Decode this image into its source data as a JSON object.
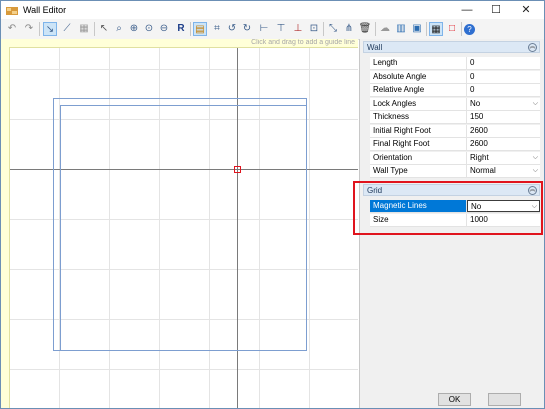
{
  "window": {
    "title": "Wall Editor",
    "minimize_glyph": "—",
    "maximize_glyph": "☐",
    "close_glyph": "✕"
  },
  "canvas": {
    "hint": "Click and drag to add a guide line"
  },
  "wall_group": {
    "label": "Wall",
    "properties": [
      {
        "name": "Length",
        "value": "0",
        "dropdown": false
      },
      {
        "name": "Absolute Angle",
        "value": "0",
        "dropdown": false
      },
      {
        "name": "Relative Angle",
        "value": "0",
        "dropdown": false
      },
      {
        "name": "Lock Angles",
        "value": "No",
        "dropdown": true
      },
      {
        "name": "Thickness",
        "value": "150",
        "dropdown": false
      },
      {
        "name": "Initial Right Foot",
        "value": "2600",
        "dropdown": false
      },
      {
        "name": "Final Right Foot",
        "value": "2600",
        "dropdown": false
      },
      {
        "name": "Orientation",
        "value": "Right",
        "dropdown": true
      },
      {
        "name": "Wall Type",
        "value": "Normal",
        "dropdown": true
      }
    ]
  },
  "grid_group": {
    "label": "Grid",
    "properties": [
      {
        "name": "Magnetic Lines",
        "value": "No",
        "dropdown": true,
        "selected": true
      },
      {
        "name": "Size",
        "value": "1000",
        "dropdown": false
      }
    ]
  },
  "buttons": {
    "ok": "OK",
    "cancel": ""
  },
  "colors": {
    "accent": "#0078d7",
    "highlight": "#e0141e",
    "wall_outline": "#7d9ed0",
    "ruler": "#ffffd8"
  }
}
